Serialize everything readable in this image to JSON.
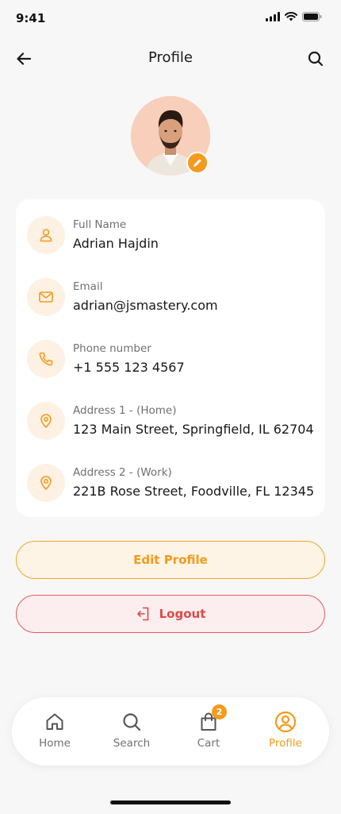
{
  "status_bar": {
    "time": "9:41"
  },
  "header": {
    "title": "Profile"
  },
  "profile": {
    "fields": [
      {
        "label": "Full Name",
        "value": "Adrian Hajdin",
        "icon": "user-icon"
      },
      {
        "label": "Email",
        "value": "adrian@jsmastery.com",
        "icon": "mail-icon"
      },
      {
        "label": "Phone number",
        "value": "+1 555 123 4567",
        "icon": "phone-icon"
      },
      {
        "label": "Address 1 - (Home)",
        "value": "123 Main Street, Springfield, IL 62704",
        "icon": "location-pin-icon"
      },
      {
        "label": "Address 2 - (Work)",
        "value": "221B Rose Street, Foodville, FL 12345",
        "icon": "location-pin-icon"
      }
    ]
  },
  "actions": {
    "edit_label": "Edit Profile",
    "logout_label": "Logout"
  },
  "tab_bar": {
    "tabs": [
      {
        "label": "Home",
        "icon": "home-icon"
      },
      {
        "label": "Search",
        "icon": "search-icon"
      },
      {
        "label": "Cart",
        "icon": "shopping-bag-icon",
        "badge": "2"
      },
      {
        "label": "Profile",
        "icon": "user-circle-icon",
        "active": true
      }
    ]
  },
  "colors": {
    "accent": "#F59A1C",
    "danger": "#E04848",
    "background": "#F7F7F7"
  }
}
